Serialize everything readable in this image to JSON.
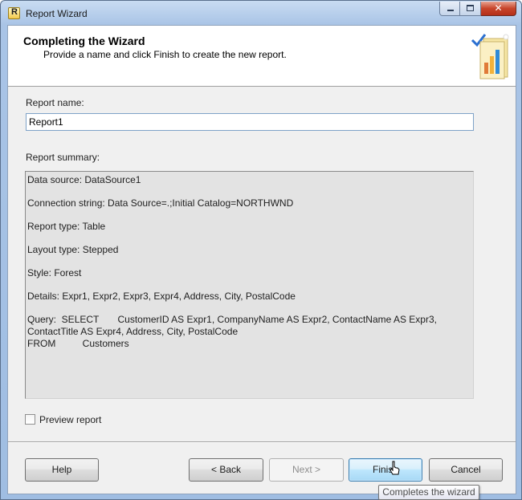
{
  "window": {
    "title": "Report Wizard",
    "icon": "report-wizard-icon",
    "controls": {
      "minimize": "minimize-icon",
      "maximize": "maximize-icon",
      "close": "✕"
    }
  },
  "header": {
    "title": "Completing the Wizard",
    "subtitle": "Provide a name and click Finish to create the new report.",
    "graphic": "wizard-report-graphic-icon"
  },
  "form": {
    "report_name_label": "Report name:",
    "report_name_value": "Report1",
    "summary_label": "Report summary:",
    "summary": {
      "data_source": "Data source: DataSource1",
      "connection_string": "Connection string: Data Source=.;Initial Catalog=NORTHWND",
      "report_type": "Report type: Table",
      "layout_type": "Layout type: Stepped",
      "style": "Style: Forest",
      "details": "Details: Expr1, Expr2, Expr3, Expr4, Address, City, PostalCode",
      "query": "Query:  SELECT       CustomerID AS Expr1, CompanyName AS Expr2, ContactName AS Expr3, ContactTitle AS Expr4, Address, City, PostalCode\nFROM          Customers"
    },
    "preview_label": "Preview report",
    "preview_checked": false
  },
  "buttons": {
    "help": "Help",
    "back": "< Back",
    "next": "Next >",
    "finish": "Finish",
    "cancel": "Cancel"
  },
  "tooltip": "Completes the wizard"
}
